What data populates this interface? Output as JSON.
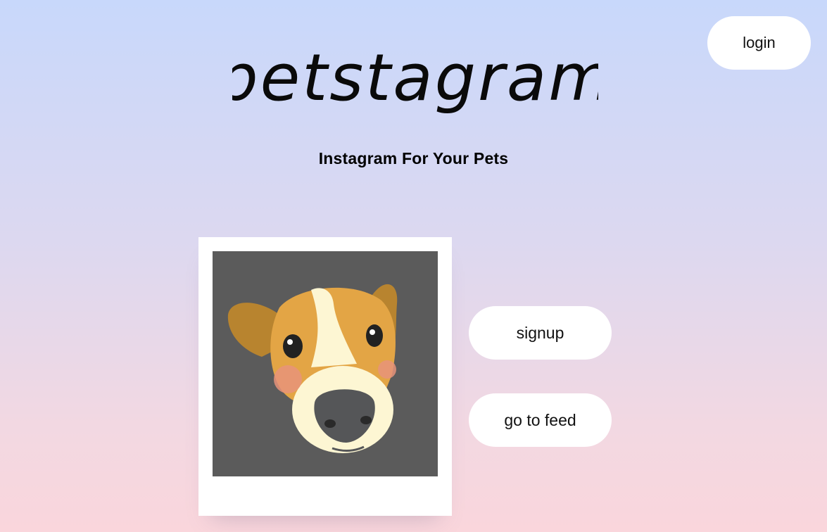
{
  "header": {
    "logo_text": "petstagram",
    "tagline": "Instagram For Your Pets",
    "login_label": "login"
  },
  "main": {
    "signup_label": "signup",
    "feed_label": "go to feed"
  },
  "colors": {
    "bg_top": "#c8d8fb",
    "bg_bottom": "#fad6dc",
    "button": "#ffffff",
    "photo_bg": "#5b5b5b",
    "dog_orange": "#e3a545",
    "dog_cream": "#fdf6d3"
  },
  "icons": {
    "hero_image": "dog-face-illustration"
  }
}
